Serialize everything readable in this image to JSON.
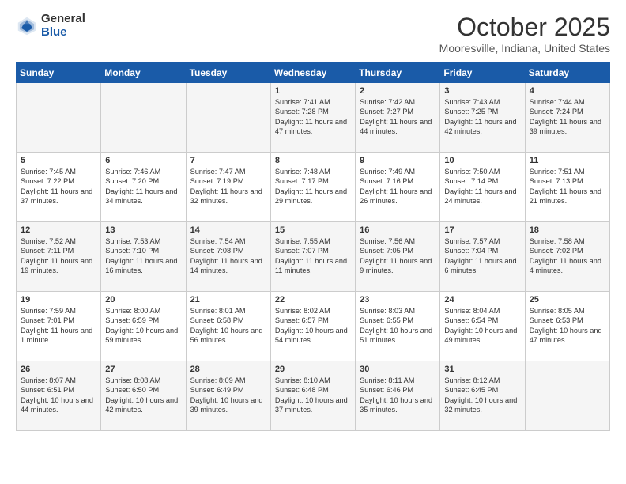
{
  "logo": {
    "general": "General",
    "blue": "Blue"
  },
  "header": {
    "month": "October 2025",
    "location": "Mooresville, Indiana, United States"
  },
  "days_of_week": [
    "Sunday",
    "Monday",
    "Tuesday",
    "Wednesday",
    "Thursday",
    "Friday",
    "Saturday"
  ],
  "weeks": [
    [
      {
        "day": "",
        "data": ""
      },
      {
        "day": "",
        "data": ""
      },
      {
        "day": "",
        "data": ""
      },
      {
        "day": "1",
        "data": "Sunrise: 7:41 AM\nSunset: 7:28 PM\nDaylight: 11 hours and 47 minutes."
      },
      {
        "day": "2",
        "data": "Sunrise: 7:42 AM\nSunset: 7:27 PM\nDaylight: 11 hours and 44 minutes."
      },
      {
        "day": "3",
        "data": "Sunrise: 7:43 AM\nSunset: 7:25 PM\nDaylight: 11 hours and 42 minutes."
      },
      {
        "day": "4",
        "data": "Sunrise: 7:44 AM\nSunset: 7:24 PM\nDaylight: 11 hours and 39 minutes."
      }
    ],
    [
      {
        "day": "5",
        "data": "Sunrise: 7:45 AM\nSunset: 7:22 PM\nDaylight: 11 hours and 37 minutes."
      },
      {
        "day": "6",
        "data": "Sunrise: 7:46 AM\nSunset: 7:20 PM\nDaylight: 11 hours and 34 minutes."
      },
      {
        "day": "7",
        "data": "Sunrise: 7:47 AM\nSunset: 7:19 PM\nDaylight: 11 hours and 32 minutes."
      },
      {
        "day": "8",
        "data": "Sunrise: 7:48 AM\nSunset: 7:17 PM\nDaylight: 11 hours and 29 minutes."
      },
      {
        "day": "9",
        "data": "Sunrise: 7:49 AM\nSunset: 7:16 PM\nDaylight: 11 hours and 26 minutes."
      },
      {
        "day": "10",
        "data": "Sunrise: 7:50 AM\nSunset: 7:14 PM\nDaylight: 11 hours and 24 minutes."
      },
      {
        "day": "11",
        "data": "Sunrise: 7:51 AM\nSunset: 7:13 PM\nDaylight: 11 hours and 21 minutes."
      }
    ],
    [
      {
        "day": "12",
        "data": "Sunrise: 7:52 AM\nSunset: 7:11 PM\nDaylight: 11 hours and 19 minutes."
      },
      {
        "day": "13",
        "data": "Sunrise: 7:53 AM\nSunset: 7:10 PM\nDaylight: 11 hours and 16 minutes."
      },
      {
        "day": "14",
        "data": "Sunrise: 7:54 AM\nSunset: 7:08 PM\nDaylight: 11 hours and 14 minutes."
      },
      {
        "day": "15",
        "data": "Sunrise: 7:55 AM\nSunset: 7:07 PM\nDaylight: 11 hours and 11 minutes."
      },
      {
        "day": "16",
        "data": "Sunrise: 7:56 AM\nSunset: 7:05 PM\nDaylight: 11 hours and 9 minutes."
      },
      {
        "day": "17",
        "data": "Sunrise: 7:57 AM\nSunset: 7:04 PM\nDaylight: 11 hours and 6 minutes."
      },
      {
        "day": "18",
        "data": "Sunrise: 7:58 AM\nSunset: 7:02 PM\nDaylight: 11 hours and 4 minutes."
      }
    ],
    [
      {
        "day": "19",
        "data": "Sunrise: 7:59 AM\nSunset: 7:01 PM\nDaylight: 11 hours and 1 minute."
      },
      {
        "day": "20",
        "data": "Sunrise: 8:00 AM\nSunset: 6:59 PM\nDaylight: 10 hours and 59 minutes."
      },
      {
        "day": "21",
        "data": "Sunrise: 8:01 AM\nSunset: 6:58 PM\nDaylight: 10 hours and 56 minutes."
      },
      {
        "day": "22",
        "data": "Sunrise: 8:02 AM\nSunset: 6:57 PM\nDaylight: 10 hours and 54 minutes."
      },
      {
        "day": "23",
        "data": "Sunrise: 8:03 AM\nSunset: 6:55 PM\nDaylight: 10 hours and 51 minutes."
      },
      {
        "day": "24",
        "data": "Sunrise: 8:04 AM\nSunset: 6:54 PM\nDaylight: 10 hours and 49 minutes."
      },
      {
        "day": "25",
        "data": "Sunrise: 8:05 AM\nSunset: 6:53 PM\nDaylight: 10 hours and 47 minutes."
      }
    ],
    [
      {
        "day": "26",
        "data": "Sunrise: 8:07 AM\nSunset: 6:51 PM\nDaylight: 10 hours and 44 minutes."
      },
      {
        "day": "27",
        "data": "Sunrise: 8:08 AM\nSunset: 6:50 PM\nDaylight: 10 hours and 42 minutes."
      },
      {
        "day": "28",
        "data": "Sunrise: 8:09 AM\nSunset: 6:49 PM\nDaylight: 10 hours and 39 minutes."
      },
      {
        "day": "29",
        "data": "Sunrise: 8:10 AM\nSunset: 6:48 PM\nDaylight: 10 hours and 37 minutes."
      },
      {
        "day": "30",
        "data": "Sunrise: 8:11 AM\nSunset: 6:46 PM\nDaylight: 10 hours and 35 minutes."
      },
      {
        "day": "31",
        "data": "Sunrise: 8:12 AM\nSunset: 6:45 PM\nDaylight: 10 hours and 32 minutes."
      },
      {
        "day": "",
        "data": ""
      }
    ]
  ]
}
